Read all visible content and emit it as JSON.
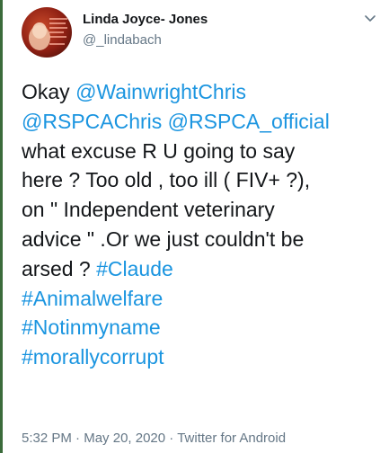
{
  "user": {
    "name": "Linda Joyce- Jones",
    "handle": "@_lindabach",
    "avatar_icon": "profile-photo"
  },
  "tweet": {
    "segments": [
      {
        "text": "Okay ",
        "type": "text"
      },
      {
        "text": "@WainwrightChris",
        "type": "link"
      },
      {
        "text": "\n",
        "type": "text"
      },
      {
        "text": "@RSPCAChris",
        "type": "link"
      },
      {
        "text": " ",
        "type": "text"
      },
      {
        "text": "@RSPCA_official",
        "type": "link"
      },
      {
        "text": "\nwhat excuse R U going to say\nhere ? Too old , too ill ( FIV+ ?),\non \" Independent veterinary\nadvice \" .Or we just couldn't be\narsed ? ",
        "type": "text"
      },
      {
        "text": "#Claude",
        "type": "link"
      },
      {
        "text": "\n",
        "type": "text"
      },
      {
        "text": "#Animalwelfare",
        "type": "link"
      },
      {
        "text": "\n",
        "type": "text"
      },
      {
        "text": "#Notinmyname",
        "type": "link"
      },
      {
        "text": "\n",
        "type": "text"
      },
      {
        "text": "#morallycorrupt",
        "type": "link"
      }
    ],
    "time": "5:32 PM",
    "separator": " · ",
    "date": "May 20, 2020",
    "source": "Twitter for Android"
  },
  "colors": {
    "link": "#1b95e0",
    "meta": "#657786",
    "text": "#14171a"
  },
  "menu_icon": "chevron-down-icon"
}
